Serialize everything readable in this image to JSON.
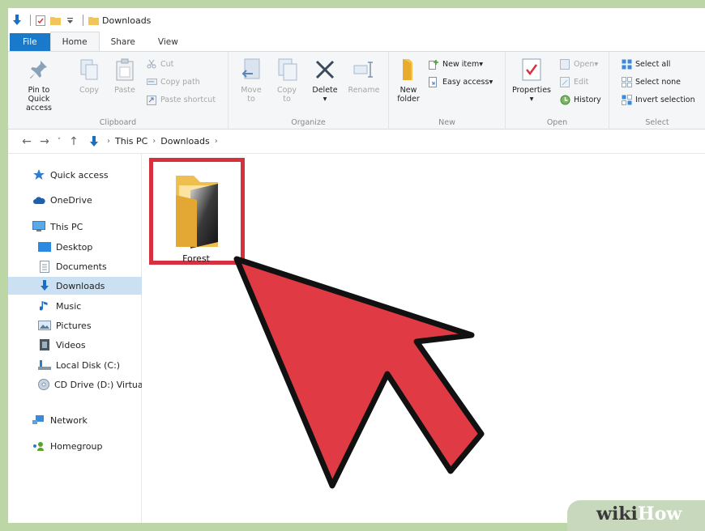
{
  "window": {
    "title": "Downloads"
  },
  "tabs": [
    "File",
    "Home",
    "Share",
    "View"
  ],
  "ribbon": {
    "clipboard": {
      "pin": [
        "Pin to Quick",
        "access"
      ],
      "copy": "Copy",
      "paste": "Paste",
      "cut": "Cut",
      "copy_path": "Copy path",
      "paste_shortcut": "Paste shortcut",
      "label": "Clipboard"
    },
    "organize": {
      "move_to": [
        "Move",
        "to"
      ],
      "copy_to": [
        "Copy",
        "to"
      ],
      "delete": "Delete",
      "rename": "Rename",
      "label": "Organize"
    },
    "new": {
      "new_folder": [
        "New",
        "folder"
      ],
      "new_item": "New item",
      "easy_access": "Easy access",
      "label": "New"
    },
    "open": {
      "properties": "Properties",
      "open": "Open",
      "edit": "Edit",
      "history": "History",
      "label": "Open"
    },
    "select": {
      "select_all": "Select all",
      "select_none": "Select none",
      "invert": "Invert selection",
      "label": "Select"
    }
  },
  "address": {
    "crumbs": [
      "This PC",
      "Downloads"
    ]
  },
  "sidebar": {
    "items": [
      {
        "label": "Quick access"
      },
      {
        "label": "OneDrive"
      },
      {
        "label": "This PC"
      },
      {
        "label": "Desktop"
      },
      {
        "label": "Documents"
      },
      {
        "label": "Downloads"
      },
      {
        "label": "Music"
      },
      {
        "label": "Pictures"
      },
      {
        "label": "Videos"
      },
      {
        "label": "Local Disk (C:)"
      },
      {
        "label": "CD Drive (D:) Virtua"
      },
      {
        "label": "Network"
      },
      {
        "label": "Homegroup"
      }
    ]
  },
  "content": {
    "files": [
      {
        "name": "Forest"
      }
    ]
  },
  "watermark": {
    "part1": "wiki",
    "part2": "How"
  },
  "colors": {
    "accent": "#1979ca",
    "highlight": "#d7303f",
    "selected": "#cce0f4"
  }
}
